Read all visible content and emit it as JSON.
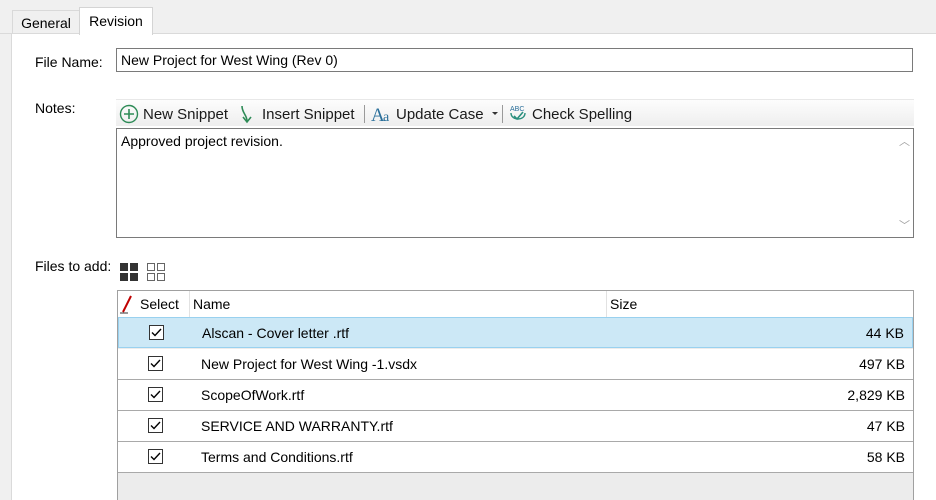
{
  "tabs": [
    {
      "label": "General",
      "active": false
    },
    {
      "label": "Revision",
      "active": true
    }
  ],
  "form": {
    "file_name_label": "File Name:",
    "file_name_value": "New Project for West Wing  (Rev 0)",
    "notes_label": "Notes:",
    "notes_value": "Approved project revision.",
    "files_label": "Files to add:"
  },
  "toolbar": {
    "new_snippet": "New Snippet",
    "insert_snippet": "Insert Snippet",
    "update_case": "Update Case",
    "check_spelling": "Check Spelling"
  },
  "grid": {
    "columns": [
      "Select",
      "Name",
      "Size"
    ],
    "rows": [
      {
        "checked": true,
        "name": "Alscan - Cover letter .rtf",
        "size": "44 KB",
        "selected": true
      },
      {
        "checked": true,
        "name": "New Project for West Wing -1.vsdx",
        "size": "497 KB",
        "selected": false
      },
      {
        "checked": true,
        "name": "ScopeOfWork.rtf",
        "size": "2,829 KB",
        "selected": false
      },
      {
        "checked": true,
        "name": "SERVICE AND WARRANTY.rtf",
        "size": "47 KB",
        "selected": false
      },
      {
        "checked": true,
        "name": "Terms and Conditions.rtf",
        "size": "58 KB",
        "selected": false
      }
    ]
  },
  "colors": {
    "selected_row": "#cce8f6",
    "toolbar_icon": "#2a6f9a",
    "check_icon_accent": "#2a8f7e"
  },
  "icons": [
    "plus-circle-icon",
    "arrow-down-curve-icon",
    "update-case-icon",
    "spell-check-icon",
    "large-icons-view-icon",
    "small-icons-view-icon",
    "pencil-icon"
  ]
}
